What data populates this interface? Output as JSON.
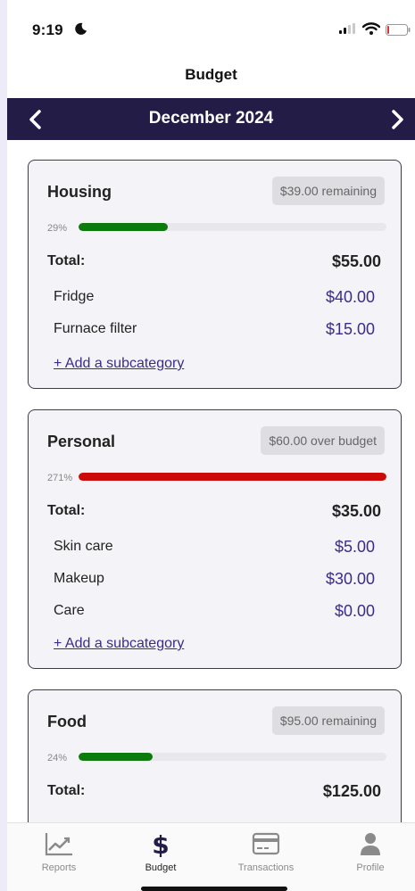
{
  "status": {
    "time": "9:19"
  },
  "nav": {
    "title": "Budget"
  },
  "month": {
    "label": "December 2024"
  },
  "colors": {
    "header": "#221c47",
    "accent": "#3a2d8a",
    "under_budget": "#0c7a0c",
    "over_budget": "#cc0a0a"
  },
  "cards": [
    {
      "title": "Housing",
      "badge": "$39.00 remaining",
      "percent_label": "29%",
      "progress": 0.29,
      "total_label": "Total:",
      "total_value": "$55.00",
      "items": [
        {
          "name": "Fridge",
          "amount": "$40.00"
        },
        {
          "name": "Furnace filter",
          "amount": "$15.00"
        }
      ],
      "add_label": "+ Add a subcategory"
    },
    {
      "title": "Personal",
      "badge": "$60.00 over budget",
      "percent_label": "271%",
      "progress": 1.0,
      "total_label": "Total:",
      "total_value": "$35.00",
      "items": [
        {
          "name": "Skin care",
          "amount": "$5.00"
        },
        {
          "name": "Makeup",
          "amount": "$30.00"
        },
        {
          "name": "Care",
          "amount": "$0.00"
        }
      ],
      "add_label": "+ Add a subcategory"
    },
    {
      "title": "Food",
      "badge": "$95.00 remaining",
      "percent_label": "24%",
      "progress": 0.24,
      "total_label": "Total:",
      "total_value": "$125.00",
      "items": [],
      "add_label": ""
    }
  ],
  "tabs": [
    {
      "label": "Reports",
      "icon": "chart-icon",
      "active": false
    },
    {
      "label": "Budget",
      "icon": "dollar-icon",
      "active": true
    },
    {
      "label": "Transactions",
      "icon": "credit-card-icon",
      "active": false
    },
    {
      "label": "Profile",
      "icon": "person-icon",
      "active": false
    }
  ]
}
